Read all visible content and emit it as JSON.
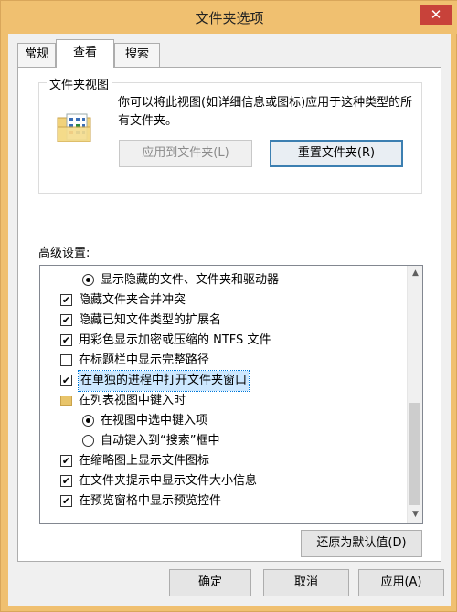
{
  "window": {
    "title": "文件夹选项",
    "close_glyph": "✕"
  },
  "tabs": [
    {
      "label": "常规",
      "active": false
    },
    {
      "label": "查看",
      "active": true
    },
    {
      "label": "搜索",
      "active": false
    }
  ],
  "folder_views": {
    "group_title": "文件夹视图",
    "description": "你可以将此视图(如详细信息或图标)应用于这种类型的所有文件夹。",
    "apply_button": "应用到文件夹(L)",
    "reset_button": "重置文件夹(R)"
  },
  "advanced": {
    "label": "高级设置:",
    "items": [
      {
        "type": "radio",
        "checked": true,
        "indent": 2,
        "label": "显示隐藏的文件、文件夹和驱动器"
      },
      {
        "type": "checkbox",
        "checked": true,
        "indent": 1,
        "label": "隐藏文件夹合并冲突"
      },
      {
        "type": "checkbox",
        "checked": true,
        "indent": 1,
        "label": "隐藏已知文件类型的扩展名"
      },
      {
        "type": "checkbox",
        "checked": true,
        "indent": 1,
        "label": "用彩色显示加密或压缩的 NTFS 文件"
      },
      {
        "type": "checkbox",
        "checked": false,
        "indent": 1,
        "label": "在标题栏中显示完整路径"
      },
      {
        "type": "checkbox",
        "checked": true,
        "indent": 1,
        "label": "在单独的进程中打开文件夹窗口",
        "selected": true
      },
      {
        "type": "folder",
        "checked": false,
        "indent": 1,
        "label": "在列表视图中键入时"
      },
      {
        "type": "radio",
        "checked": true,
        "indent": 2,
        "label": "在视图中选中键入项"
      },
      {
        "type": "radio",
        "checked": false,
        "indent": 2,
        "label": "自动键入到“搜索”框中"
      },
      {
        "type": "checkbox",
        "checked": true,
        "indent": 1,
        "label": "在缩略图上显示文件图标"
      },
      {
        "type": "checkbox",
        "checked": true,
        "indent": 1,
        "label": "在文件夹提示中显示文件大小信息"
      },
      {
        "type": "checkbox",
        "checked": true,
        "indent": 1,
        "label": "在预览窗格中显示预览控件"
      }
    ],
    "restore_button": "还原为默认值(D)"
  },
  "footer": {
    "ok": "确定",
    "cancel": "取消",
    "apply": "应用(A)"
  },
  "icons": {
    "checked_glyph": "✔",
    "scroll_up_glyph": "▲",
    "scroll_down_glyph": "▼"
  },
  "colors": {
    "titlebar": "#f0c070",
    "close": "#c8423a",
    "selection": "#cde8ff",
    "focus": "#3c7fb1"
  }
}
